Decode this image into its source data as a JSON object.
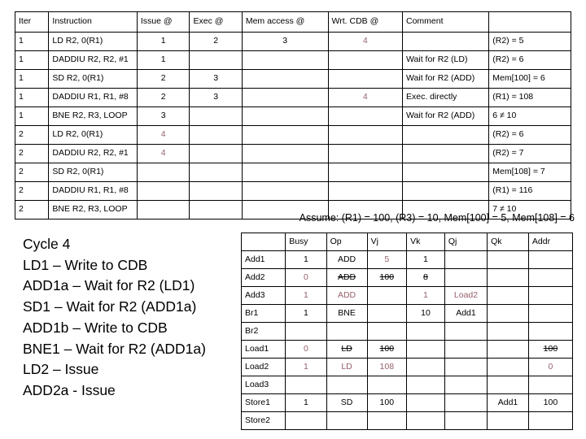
{
  "colors": {
    "ink": "#000000",
    "highlight_red": "#96616b",
    "border": "#000000",
    "background": "#ffffff"
  },
  "pipeline_table": {
    "name": "instruction-pipeline-timing-table",
    "headers": [
      "Iter",
      "Instruction",
      "Issue @",
      "Exec @",
      "Mem access @",
      "Wrt. CDB @",
      "Comment",
      ""
    ],
    "rows": [
      {
        "iter": "1",
        "instruction": "LD R2, 0(R1)",
        "issue": "1",
        "exec": "2",
        "mem": "3",
        "cdb": "4",
        "cdb_style": "red",
        "comment": "",
        "extra": "(R2) = 5"
      },
      {
        "iter": "1",
        "instruction": "DADDIU R2, R2, #1",
        "issue": "1",
        "exec": "",
        "mem": "",
        "cdb": "",
        "cdb_style": "",
        "comment": "Wait for R2 (LD)",
        "extra": "(R2) = 6"
      },
      {
        "iter": "1",
        "instruction": "SD R2, 0(R1)",
        "issue": "2",
        "exec": "3",
        "mem": "",
        "cdb": "",
        "cdb_style": "",
        "comment": "Wait for R2 (ADD)",
        "extra": "Mem[100] = 6"
      },
      {
        "iter": "1",
        "instruction": "DADDIU R1, R1, #8",
        "issue": "2",
        "exec": "3",
        "mem": "",
        "cdb": "4",
        "cdb_style": "red",
        "comment": "Exec. directly",
        "extra": "(R1) = 108"
      },
      {
        "iter": "1",
        "instruction": "BNE R2, R3, LOOP",
        "issue": "3",
        "exec": "",
        "mem": "",
        "cdb": "",
        "cdb_style": "",
        "comment": "Wait for R2 (ADD)",
        "extra": "6 ≠ 10"
      },
      {
        "iter": "2",
        "instruction": "LD R2, 0(R1)",
        "issue": "4",
        "issue_style": "red",
        "exec": "",
        "mem": "",
        "cdb": "",
        "cdb_style": "",
        "comment": "",
        "extra": "(R2) = 6"
      },
      {
        "iter": "2",
        "instruction": "DADDIU R2, R2, #1",
        "issue": "4",
        "issue_style": "red",
        "exec": "",
        "mem": "",
        "cdb": "",
        "cdb_style": "",
        "comment": "",
        "extra": "(R2) = 7"
      },
      {
        "iter": "2",
        "instruction": "SD R2, 0(R1)",
        "issue": "",
        "exec": "",
        "mem": "",
        "cdb": "",
        "cdb_style": "",
        "comment": "",
        "extra": "Mem[108] = 7"
      },
      {
        "iter": "2",
        "instruction": "DADDIU R1, R1, #8",
        "issue": "",
        "exec": "",
        "mem": "",
        "cdb": "",
        "cdb_style": "",
        "comment": "",
        "extra": "(R1) = 116"
      },
      {
        "iter": "2",
        "instruction": "BNE R2, R3, LOOP",
        "issue": "",
        "exec": "",
        "mem": "",
        "cdb": "",
        "cdb_style": "",
        "comment": "",
        "extra": "7 ≠ 10"
      }
    ]
  },
  "assume": {
    "text": "Assume: (R1) = 100, (R3) = 10, Mem[100] = 5, Mem[108] = 6"
  },
  "cycle_notes": {
    "title": "Cycle 4",
    "lines": [
      "LD1 – Write to CDB",
      "ADD1a – Wait for R2 (LD1)",
      "SD1 – Wait for R2 (ADD1a)",
      "ADD1b – Write to CDB",
      "BNE1 – Wait for R2 (ADD1a)",
      "LD2 – Issue",
      "ADD2a - Issue"
    ]
  },
  "rs_table": {
    "name": "reservation-station-table",
    "headers": [
      "",
      "Busy",
      "Op",
      "Vj",
      "Vk",
      "Qj",
      "Qk",
      "Addr"
    ],
    "rows": [
      {
        "label": "Add1",
        "cells": [
          {
            "t": "1",
            "s": ""
          },
          {
            "t": "ADD",
            "s": ""
          },
          {
            "t": "5",
            "s": "red"
          },
          {
            "t": "1",
            "s": ""
          },
          {
            "t": "",
            "s": ""
          },
          {
            "t": "",
            "s": ""
          },
          {
            "t": "",
            "s": ""
          }
        ]
      },
      {
        "label": "Add2",
        "cells": [
          {
            "t": "0",
            "s": "red"
          },
          {
            "t": "ADD",
            "s": "strike"
          },
          {
            "t": "100",
            "s": "strike"
          },
          {
            "t": "8",
            "s": "strike"
          },
          {
            "t": "",
            "s": ""
          },
          {
            "t": "",
            "s": ""
          },
          {
            "t": "",
            "s": ""
          }
        ]
      },
      {
        "label": "Add3",
        "cells": [
          {
            "t": "1",
            "s": "red"
          },
          {
            "t": "ADD",
            "s": "red"
          },
          {
            "t": "",
            "s": ""
          },
          {
            "t": "1",
            "s": "red"
          },
          {
            "t": "Load2",
            "s": "red"
          },
          {
            "t": "",
            "s": ""
          },
          {
            "t": "",
            "s": ""
          }
        ]
      },
      {
        "label": "Br1",
        "cells": [
          {
            "t": "1",
            "s": ""
          },
          {
            "t": "BNE",
            "s": ""
          },
          {
            "t": "",
            "s": ""
          },
          {
            "t": "10",
            "s": ""
          },
          {
            "t": "Add1",
            "s": ""
          },
          {
            "t": "",
            "s": ""
          },
          {
            "t": "",
            "s": ""
          }
        ]
      },
      {
        "label": "Br2",
        "cells": [
          {
            "t": "",
            "s": ""
          },
          {
            "t": "",
            "s": ""
          },
          {
            "t": "",
            "s": ""
          },
          {
            "t": "",
            "s": ""
          },
          {
            "t": "",
            "s": ""
          },
          {
            "t": "",
            "s": ""
          },
          {
            "t": "",
            "s": ""
          }
        ]
      },
      {
        "label": "Load1",
        "cells": [
          {
            "t": "0",
            "s": "red"
          },
          {
            "t": "LD",
            "s": "strike"
          },
          {
            "t": "100",
            "s": "strike"
          },
          {
            "t": "",
            "s": ""
          },
          {
            "t": "",
            "s": ""
          },
          {
            "t": "",
            "s": ""
          },
          {
            "t": "100",
            "s": "strike"
          }
        ]
      },
      {
        "label": "Load2",
        "cells": [
          {
            "t": "1",
            "s": "red"
          },
          {
            "t": "LD",
            "s": "red"
          },
          {
            "t": "108",
            "s": "red"
          },
          {
            "t": "",
            "s": ""
          },
          {
            "t": "",
            "s": ""
          },
          {
            "t": "",
            "s": ""
          },
          {
            "t": "0",
            "s": "red"
          }
        ]
      },
      {
        "label": "Load3",
        "cells": [
          {
            "t": "",
            "s": ""
          },
          {
            "t": "",
            "s": ""
          },
          {
            "t": "",
            "s": ""
          },
          {
            "t": "",
            "s": ""
          },
          {
            "t": "",
            "s": ""
          },
          {
            "t": "",
            "s": ""
          },
          {
            "t": "",
            "s": ""
          }
        ]
      },
      {
        "label": "Store1",
        "cells": [
          {
            "t": "1",
            "s": ""
          },
          {
            "t": "SD",
            "s": ""
          },
          {
            "t": "100",
            "s": ""
          },
          {
            "t": "",
            "s": ""
          },
          {
            "t": "",
            "s": ""
          },
          {
            "t": "Add1",
            "s": ""
          },
          {
            "t": "100",
            "s": ""
          }
        ]
      },
      {
        "label": "Store2",
        "cells": [
          {
            "t": "",
            "s": ""
          },
          {
            "t": "",
            "s": ""
          },
          {
            "t": "",
            "s": ""
          },
          {
            "t": "",
            "s": ""
          },
          {
            "t": "",
            "s": ""
          },
          {
            "t": "",
            "s": ""
          },
          {
            "t": "",
            "s": ""
          }
        ]
      }
    ]
  }
}
